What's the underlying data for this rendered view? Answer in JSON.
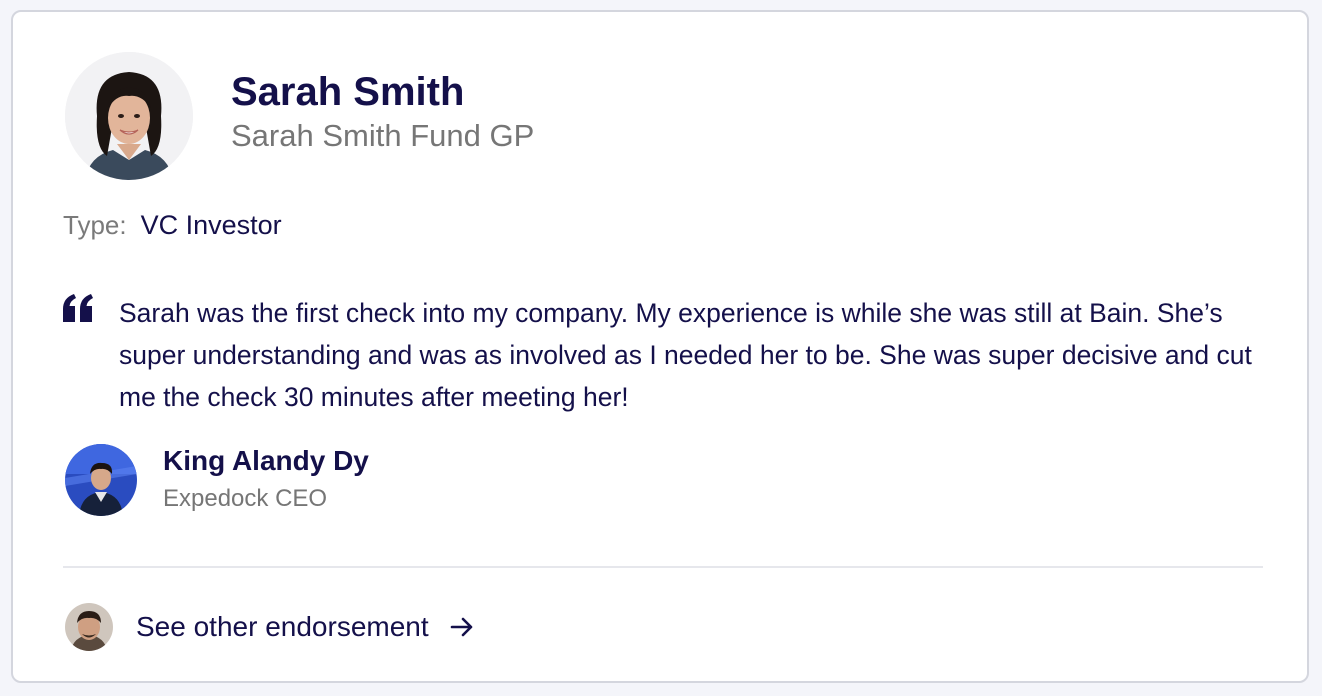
{
  "profile": {
    "name": "Sarah Smith",
    "subtitle": "Sarah Smith Fund GP",
    "avatar_icon": "portrait-woman"
  },
  "type": {
    "label": "Type:",
    "value": "VC Investor"
  },
  "endorsement": {
    "quote_icon": "quote-icon",
    "text": "Sarah was the first check into my company. My experience is while she was still at Bain. She’s super understanding and was as involved as I needed her to be. She was super decisive and cut me the check 30 minutes after meeting her!",
    "author": {
      "name": "King Alandy Dy",
      "role": "Expedock CEO",
      "avatar_icon": "portrait-man-stage"
    }
  },
  "footer": {
    "link_label": "See other endorsement",
    "arrow_icon": "arrow-right-icon",
    "avatar_icon": "portrait-man"
  },
  "colors": {
    "primary_text": "#14104a",
    "muted_text": "#767676",
    "border": "#d4d6de",
    "background": "#f4f5fa"
  }
}
